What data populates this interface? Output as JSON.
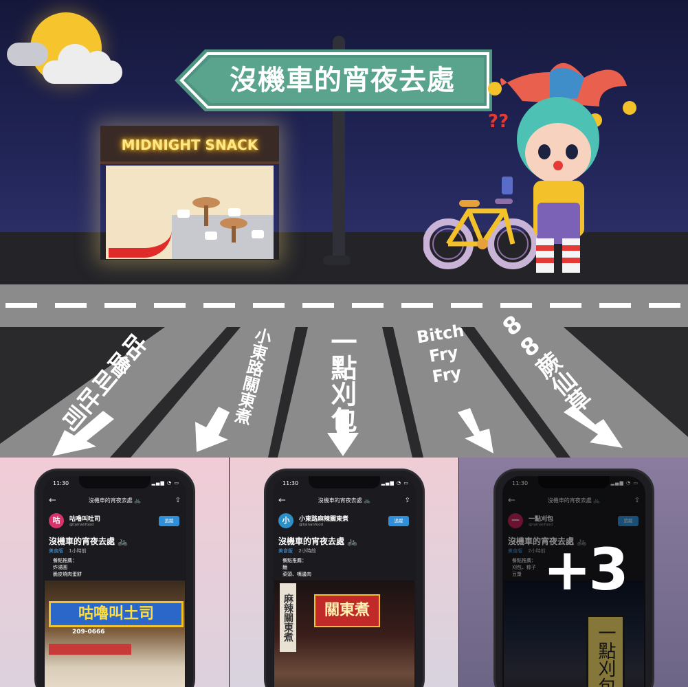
{
  "sign": {
    "title": "沒機車的宵夜去處"
  },
  "shop": {
    "name": "MIDNIGHT SNACK"
  },
  "lanes": [
    {
      "label": "咕嚕叫吐司"
    },
    {
      "label": "小東路關東煮"
    },
    {
      "label": "一點刈包"
    },
    {
      "label": "Bitch Fry Fry",
      "lines": [
        "Bitch",
        "Fry",
        "Fry"
      ]
    },
    {
      "label": "88蕨仙草"
    }
  ],
  "more_count": "+3",
  "posts": [
    {
      "status_time": "11:30",
      "nav_title": "沒機車的宵夜去處 🚲",
      "avatar": "咕",
      "avatar_color": "#d9336b",
      "author": "咕嚕叫吐司",
      "handle": "@tainanfood",
      "follow": "追蹤",
      "title": "沒機車的宵夜去處 🚲",
      "category": "美食版",
      "time": "1小時前",
      "rec_label": "餐點推薦：",
      "rec_1": "炸湯圓",
      "rec_2": "脆皮燒肉蛋餅",
      "photo_sign": "咕嚕叫土司",
      "photo_phone": "209-0666"
    },
    {
      "status_time": "11:30",
      "nav_title": "沒機車的宵夜去處 🚲",
      "avatar": "小",
      "avatar_color": "#2b8fc9",
      "author": "小東路麻辣關東煮",
      "handle": "@tainanfood",
      "follow": "追蹤",
      "title": "沒機車的宵夜去處 🚲",
      "category": "美食版",
      "time": "2小時前",
      "rec_label": "餐點推薦：",
      "rec_1": "麵",
      "rec_2": "菜頭、嘴邊肉",
      "photo_sign": "關東煮",
      "photo_side": "麻辣關東煮"
    },
    {
      "status_time": "11:30",
      "nav_title": "沒機車的宵夜去處 🚲",
      "avatar": "一",
      "avatar_color": "#c0245a",
      "author": "一點刈包",
      "handle": "@tainanfood",
      "follow": "追蹤",
      "title": "沒機車的宵夜去處 🚲",
      "category": "美食版",
      "time": "2小時前",
      "rec_label": "餐點推薦：",
      "rec_1": "刈包、粽子",
      "rec_2": "豆漿",
      "photo_sign": "一點刈包"
    }
  ],
  "colors": {
    "sky": "#1a1d47",
    "sign_green": "#5a9e8c",
    "moon": "#f6c52e",
    "road": "#2a2a2d",
    "follow_blue": "#2f8fd8"
  }
}
